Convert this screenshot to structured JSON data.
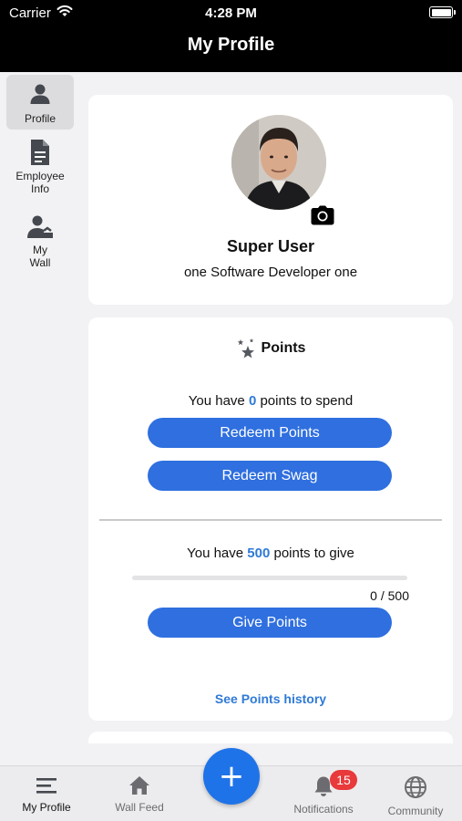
{
  "status_bar": {
    "carrier": "Carrier",
    "time": "4:28 PM"
  },
  "header": {
    "title": "My Profile"
  },
  "sidebar": {
    "items": [
      {
        "label": "Profile",
        "icon": "person-icon",
        "active": true
      },
      {
        "label": "Employee Info",
        "icon": "document-icon",
        "active": false
      },
      {
        "label": "My Wall",
        "icon": "person-wall-icon",
        "active": false
      }
    ]
  },
  "profile": {
    "name": "Super User",
    "title": "one Software Developer one",
    "camera_icon": "camera-icon"
  },
  "points": {
    "heading": "Points",
    "heading_icon": "stars-icon",
    "spend_prefix": "You have ",
    "spend_value": "0",
    "spend_suffix": " points to spend",
    "redeem_points_label": "Redeem Points",
    "redeem_swag_label": "Redeem Swag",
    "give_prefix": "You have ",
    "give_value": "500",
    "give_suffix": " points to give",
    "given_progress": 0,
    "given_count": "0 / 500",
    "give_points_label": "Give Points",
    "history_link": "See Points history"
  },
  "tabbar": {
    "tabs": [
      {
        "label": "My Profile",
        "icon": "menu-icon",
        "active": true
      },
      {
        "label": "Wall Feed",
        "icon": "home-icon",
        "active": false
      },
      {
        "label": "Notifications",
        "icon": "bell-icon",
        "active": false
      },
      {
        "label": "Community",
        "icon": "globe-icon",
        "active": false
      }
    ],
    "fab_label": "+",
    "notification_badge": "15"
  },
  "colors": {
    "accent": "#2f6fdf",
    "link": "#2f7ad6",
    "badge": "#e8393b",
    "header_bg": "#000000",
    "page_bg": "#f2f2f4"
  }
}
